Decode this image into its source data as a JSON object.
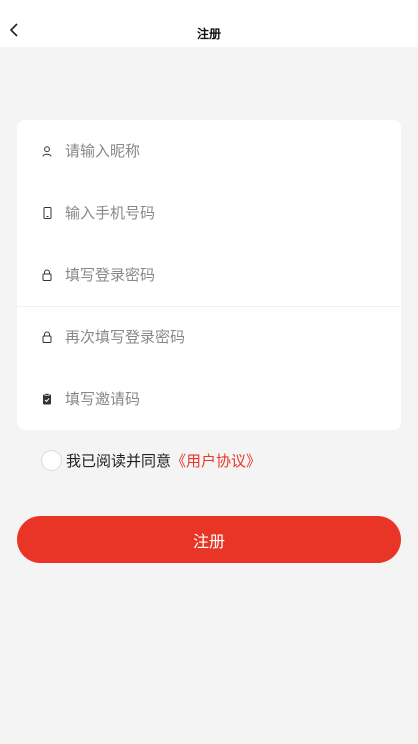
{
  "header": {
    "title": "注册",
    "back_icon": "chevron-left-icon"
  },
  "form": {
    "fields": [
      {
        "name": "nickname",
        "placeholder": "请输入昵称",
        "icon": "user-icon"
      },
      {
        "name": "phone",
        "placeholder": "输入手机号码",
        "icon": "phone-icon"
      },
      {
        "name": "password",
        "placeholder": "填写登录密码",
        "icon": "lock-icon"
      },
      {
        "name": "password-confirm",
        "placeholder": "再次填写登录密码",
        "icon": "lock-icon"
      },
      {
        "name": "invite-code",
        "placeholder": "填写邀请码",
        "icon": "clipboard-icon"
      }
    ]
  },
  "agreement": {
    "text": "我已阅读并同意",
    "link": "《用户协议》",
    "checked": false
  },
  "register_button": {
    "label": "注册"
  },
  "colors": {
    "accent": "#e93525",
    "link": "#e8382b",
    "background": "#f4f4f4"
  }
}
